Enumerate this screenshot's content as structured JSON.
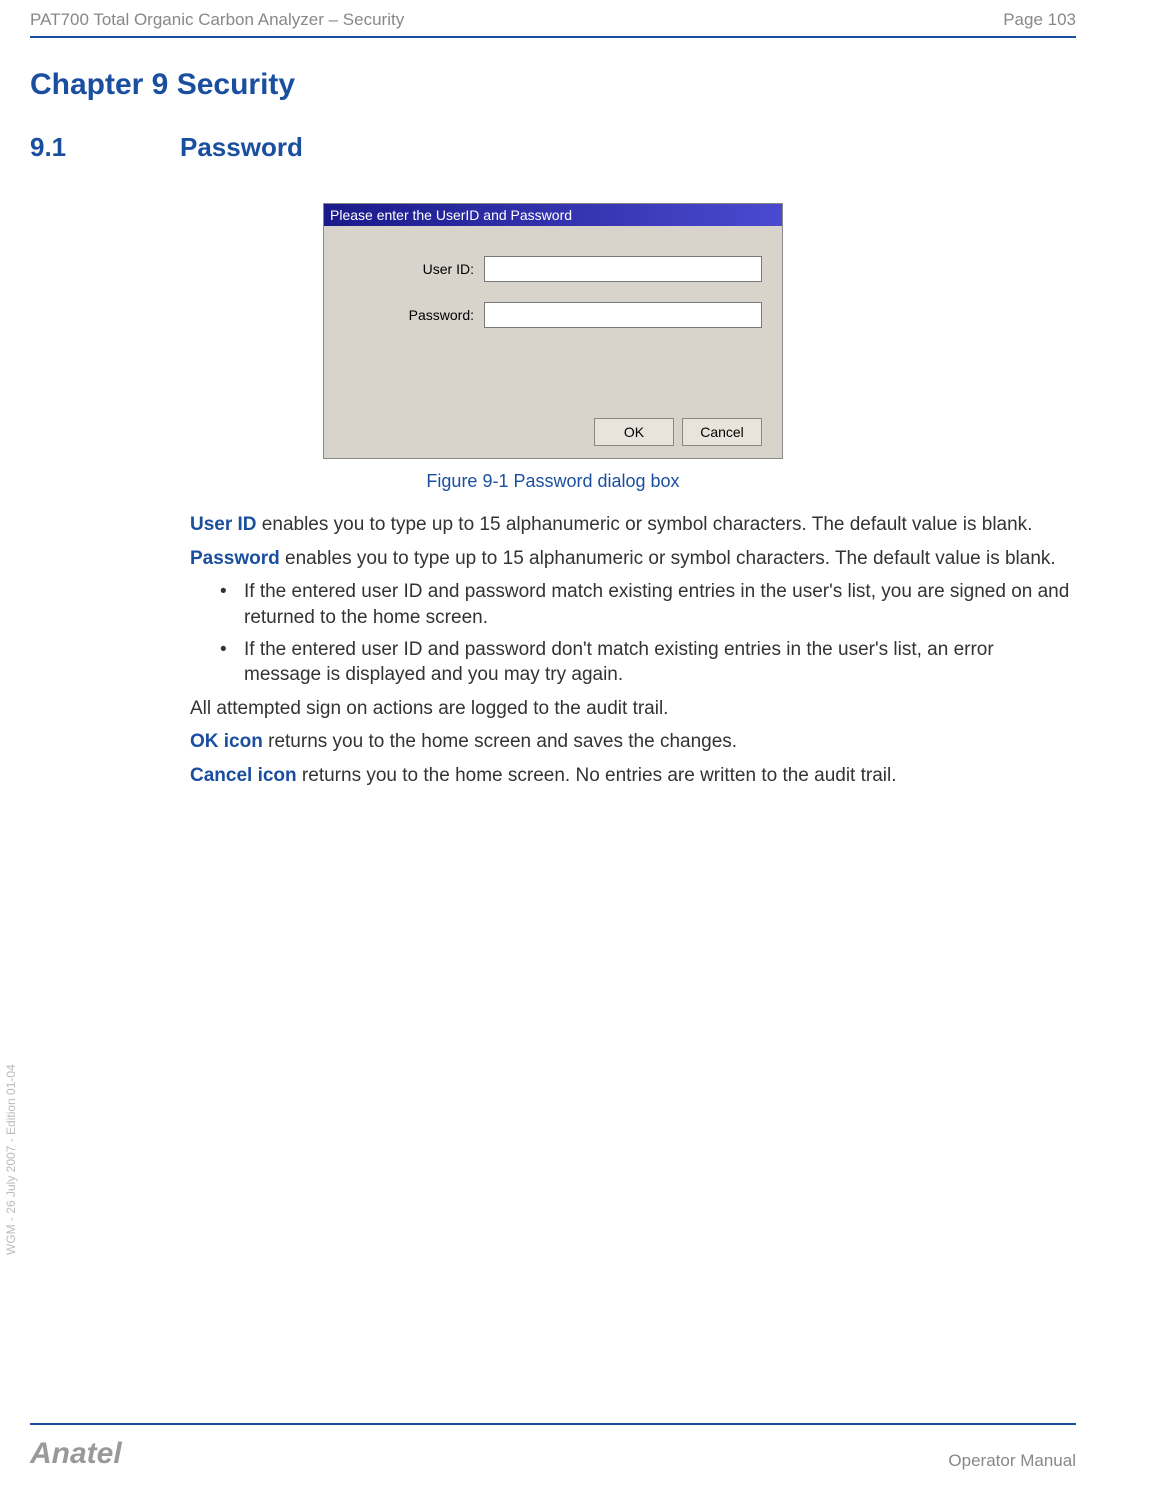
{
  "header": {
    "left": "PAT700 Total Organic Carbon Analyzer – Security",
    "right": "Page 103"
  },
  "chapter": {
    "title": "Chapter 9   Security"
  },
  "section": {
    "number": "9.1",
    "title": "Password"
  },
  "dialog": {
    "title": "Please enter the UserID and Password",
    "user_label": "User ID:",
    "password_label": "Password:",
    "ok_label": "OK",
    "cancel_label": "Cancel"
  },
  "figure_caption": "Figure 9-1 Password dialog box",
  "body": {
    "p1_term": "User ID",
    "p1_rest": " enables you to type up to 15 alphanumeric or symbol characters. The default value is blank.",
    "p2_term": "Password",
    "p2_rest": " enables you to type up to 15 alphanumeric or symbol characters. The default value is blank.",
    "li1": "If the entered user ID and password match existing entries in the user's list, you are signed on and returned to the home screen.",
    "li2": "If the entered user ID and password don't match existing entries in the user's list, an error message is displayed and you may try again.",
    "p3": "All attempted sign on actions are logged to the audit trail.",
    "p4_term": "OK icon",
    "p4_rest": " returns you to the home screen and saves the changes.",
    "p5_term": "Cancel icon",
    "p5_rest": " returns you to the home screen. No entries are written to the audit trail."
  },
  "side_text": "WGM - 26 July 2007 - Edition 01-04",
  "footer": {
    "brand": "Anatel",
    "doc": "Operator Manual"
  }
}
